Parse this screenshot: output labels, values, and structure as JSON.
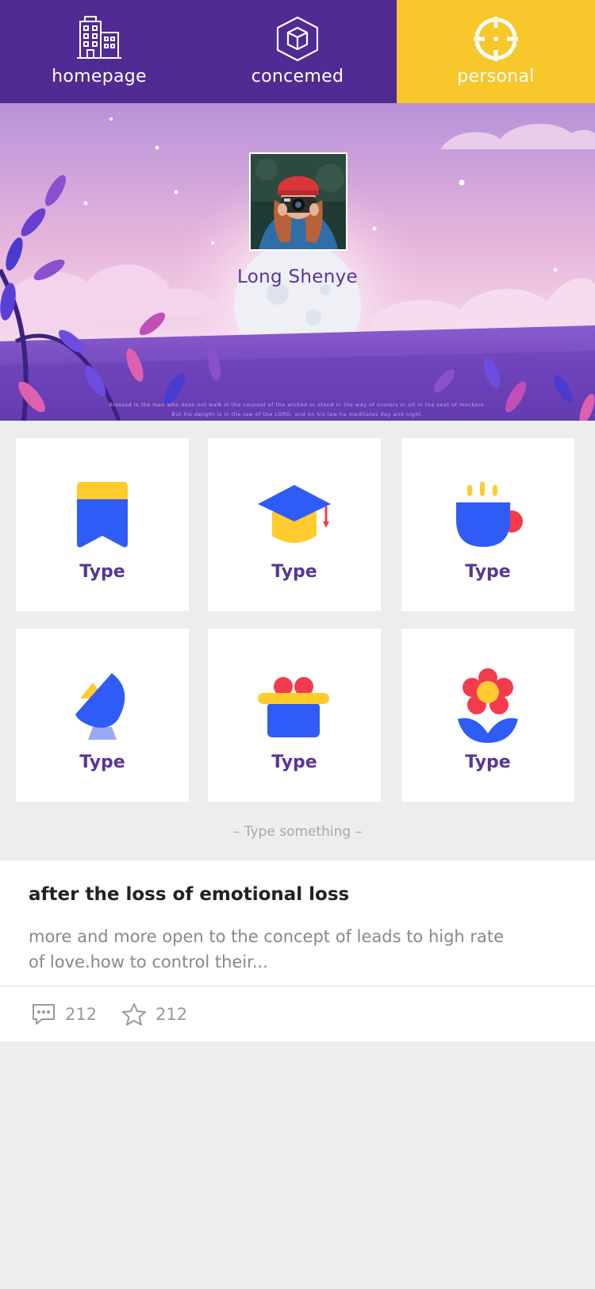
{
  "nav": {
    "tabs": [
      {
        "label": "homepage",
        "icon": "building-icon",
        "active": false
      },
      {
        "label": "concemed",
        "icon": "cube-icon",
        "active": false
      },
      {
        "label": "personal",
        "icon": "crosshair-icon",
        "active": true
      }
    ]
  },
  "profile": {
    "name": "Long Shenye",
    "avatar": "avatar-photo",
    "quote_line1": "Blessed is the man who does not walk in the counsel of the wicked or stand in the way of sinners or sit in the seat of mockers.",
    "quote_line2": "But his delight is in the law of the LORD, and on his law he meditates day and night."
  },
  "categories": [
    {
      "label": "Type",
      "icon": "bookmark-icon"
    },
    {
      "label": "Type",
      "icon": "graduation-cap-icon"
    },
    {
      "label": "Type",
      "icon": "coffee-cup-icon"
    },
    {
      "label": "Type",
      "icon": "satellite-dish-icon"
    },
    {
      "label": "Type",
      "icon": "gift-box-icon"
    },
    {
      "label": "Type",
      "icon": "flower-icon"
    }
  ],
  "section_hint": "– Type something –",
  "article": {
    "title": "after the loss of emotional loss",
    "description": "more and more open to the concept of leads to high rate of love.how to control their...",
    "comments": "212",
    "favorites": "212"
  },
  "colors": {
    "nav_bg": "#4f2b93",
    "nav_active": "#f7c72b",
    "accent_purple": "#5a3598",
    "icon_blue": "#2f5cf6",
    "icon_yellow": "#ffcb2f",
    "icon_red": "#f23b4d"
  }
}
